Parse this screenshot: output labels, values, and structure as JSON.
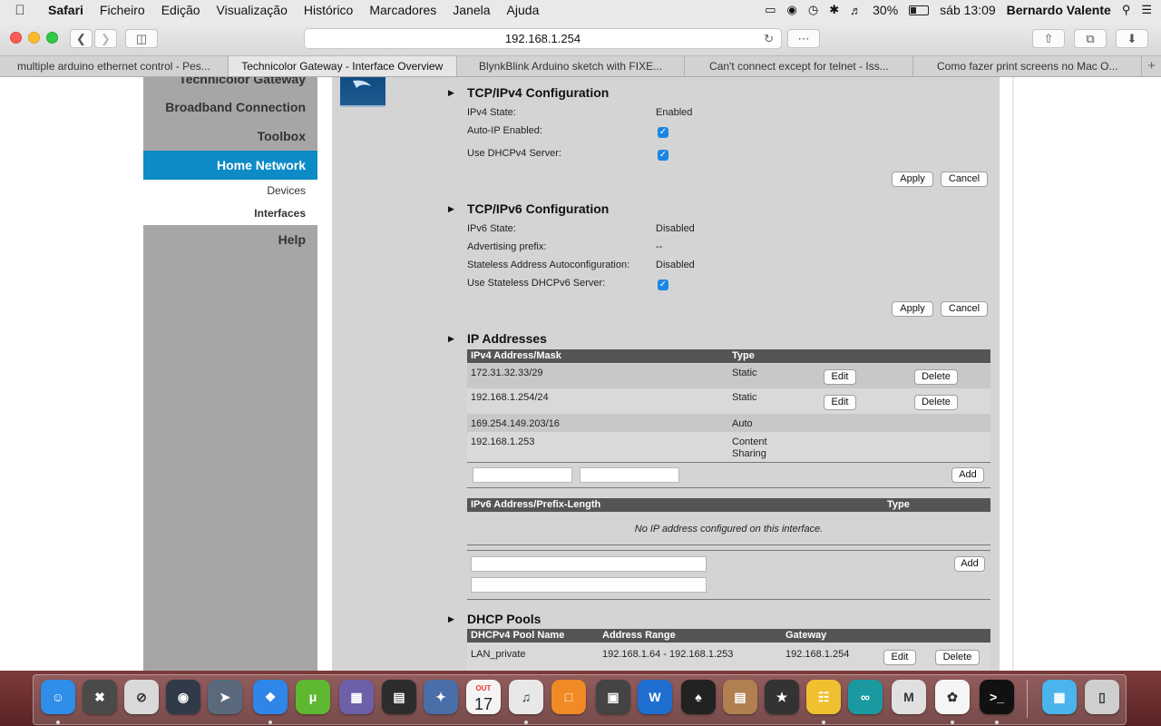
{
  "menubar": {
    "apple": "",
    "items": [
      "Safari",
      "Ficheiro",
      "Edição",
      "Visualização",
      "Histórico",
      "Marcadores",
      "Janela",
      "Ajuda"
    ],
    "battery": "30%",
    "battery_level": 0.3,
    "clock": "sáb 13:09",
    "user": "Bernardo Valente"
  },
  "safari": {
    "url": "192.168.1.254",
    "tabs": [
      "multiple arduino ethernet control - Pes...",
      "Technicolor Gateway - Interface Overview",
      "BlynkBlink Arduino sketch with FIXE...",
      "Can't connect except for telnet - Iss...",
      "Como fazer print screens no Mac O..."
    ],
    "active_tab_index": 1,
    "new_tab": "+"
  },
  "sidebar": {
    "top_partial": "Technicolor Gateway",
    "broadband": "Broadband Connection",
    "toolbox": "Toolbox",
    "home_network": "Home Network",
    "devices": "Devices",
    "interfaces": "Interfaces",
    "help": "Help"
  },
  "ipv4": {
    "title": "TCP/IPv4 Configuration",
    "state_label": "IPv4 State:",
    "state_value": "Enabled",
    "autoip_label": "Auto-IP Enabled:",
    "autoip_checked": true,
    "dhcp_label": "Use DHCPv4 Server:",
    "dhcp_checked": true,
    "apply": "Apply",
    "cancel": "Cancel"
  },
  "ipv6": {
    "title": "TCP/IPv6 Configuration",
    "state_label": "IPv6 State:",
    "state_value": "Disabled",
    "prefix_label": "Advertising prefix:",
    "prefix_value": "--",
    "slaac_label": "Stateless Address Autoconfiguration:",
    "slaac_value": "Disabled",
    "dhcp_label": "Use Stateless DHCPv6 Server:",
    "dhcp_checked": true,
    "apply": "Apply",
    "cancel": "Cancel"
  },
  "ip_addresses": {
    "title": "IP Addresses",
    "v4_headers": [
      "IPv4 Address/Mask",
      "Type"
    ],
    "v4_rows": [
      {
        "address": "172.31.32.33/29",
        "type": "Static",
        "edit": "Edit",
        "delete": "Delete"
      },
      {
        "address": "192.168.1.254/24",
        "type": "Static",
        "edit": "Edit",
        "delete": "Delete"
      },
      {
        "address": "169.254.149.203/16",
        "type": "Auto"
      },
      {
        "address": "192.168.1.253",
        "type_line1": "Content",
        "type_line2": "Sharing"
      }
    ],
    "v4_add": "Add",
    "v6_headers": [
      "IPv6 Address/Prefix-Length",
      "Type"
    ],
    "v6_empty": "No IP address configured on this interface.",
    "v6_add": "Add"
  },
  "dhcp_pools": {
    "title": "DHCP Pools",
    "headers": [
      "DHCPv4 Pool Name",
      "Address Range",
      "Gateway"
    ],
    "rows": [
      {
        "name": "LAN_private",
        "range": "192.168.1.64 - 192.168.1.253",
        "gateway": "192.168.1.254",
        "edit": "Edit",
        "delete": "Delete"
      }
    ]
  },
  "dock": {
    "apps": [
      "finder-icon",
      "gps-icon",
      "blocker-icon",
      "wifi-diag-icon",
      "launchpad-icon",
      "safari-icon",
      "utorrent-icon",
      "stack-icon",
      "activity-icon",
      "preview-icon",
      "calendar-icon",
      "itunes-icon",
      "ibooks-icon",
      "photobooth-icon",
      "word-icon",
      "pkr-icon",
      "archive-icon",
      "imovie-icon",
      "stickies-icon",
      "arduino-icon",
      "mamp-icon",
      "photos-icon",
      "terminal-icon",
      "folder-icon",
      "trash-icon"
    ],
    "calendar_month": "OUT",
    "calendar_day": "17"
  }
}
